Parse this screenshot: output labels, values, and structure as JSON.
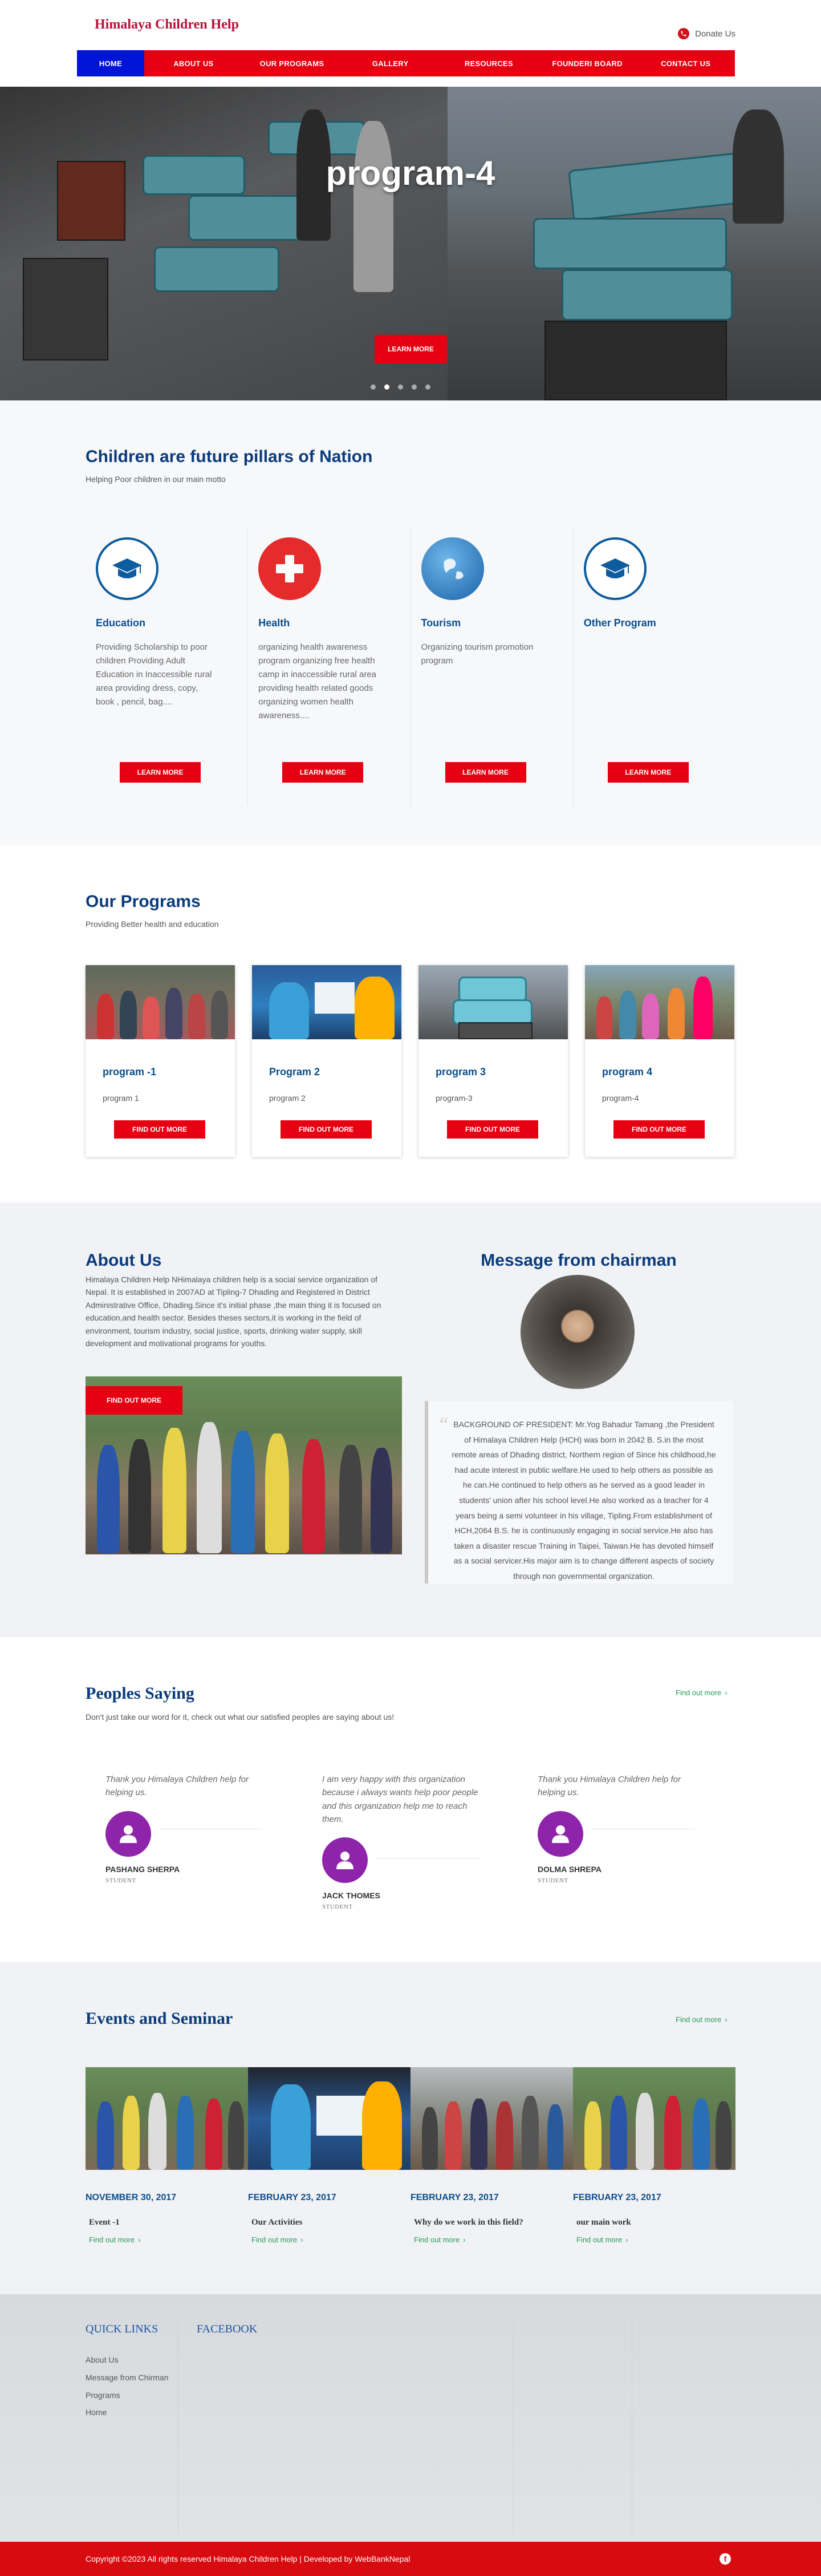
{
  "header": {
    "logo": "Himalaya Children Help",
    "donate": "Donate Us"
  },
  "nav": [
    {
      "label": "HOME"
    },
    {
      "label": "ABOUT US"
    },
    {
      "label": "OUR PROGRAMS"
    },
    {
      "label": "GALLERY"
    },
    {
      "label": "RESOURCES"
    },
    {
      "label": "FOUNDERI BOARD"
    },
    {
      "label": "CONTACT US"
    }
  ],
  "hero": {
    "title": "program-4",
    "button": "LEARN MORE",
    "slides": 5,
    "active_slide": 2
  },
  "pillars": {
    "title": "Children are future pillars of Nation",
    "subtitle": "Helping Poor children in our main motto",
    "items": [
      {
        "name": "Education",
        "icon": "graduation-cap-icon",
        "text": "Providing Scholarship to poor children Providing Adult Education in Inaccessible rural area   providing dress, copy, book , pencil, bag....",
        "button": "LEARN MORE"
      },
      {
        "name": "Health",
        "icon": "medical-cross-icon",
        "text": "organizing health awareness program organizing free health camp in inaccessible rural area providing health related goods organizing women health awareness....",
        "button": "LEARN MORE"
      },
      {
        "name": "Tourism",
        "icon": "globe-icon",
        "text": "Organizing tourism promotion program",
        "button": "LEARN MORE"
      },
      {
        "name": "Other Program",
        "icon": "graduation-cap-icon",
        "text": "",
        "button": "LEARN MORE"
      }
    ]
  },
  "programs": {
    "title": "Our Programs",
    "subtitle": "Providing Better health and education",
    "items": [
      {
        "title": "program -1",
        "text": "program 1",
        "button": "FIND OUT MORE"
      },
      {
        "title": "Program 2",
        "text": "program 2",
        "button": "FIND OUT MORE"
      },
      {
        "title": "program 3",
        "text": "program-3",
        "button": "FIND OUT MORE"
      },
      {
        "title": "program 4",
        "text": "program-4",
        "button": "FIND OUT MORE"
      }
    ]
  },
  "about": {
    "title": "About Us",
    "text": "Himalaya Children Help NHimalaya children help is a social service organization of Nepal. It is established in 2007AD at Tipling-7 Dhading and Registered in District Administrative Office, Dhading.Since it's initial phase ,the main thing it is focused on education,and health sector. Besides theses sectors,it is working in the field of environment, tourism industry, social justice, sports, drinking water supply, skill development and motivational programs for youths.",
    "button": "FIND OUT MORE"
  },
  "chairman": {
    "title": "Message from chairman",
    "message": "BACKGROUND OF PRESIDENT: Mr.Yog Bahadur Tamang ,the President of Himalaya Children Help (HCH) was born in 2042 B. S.in the most remote areas of Dhading district, Northern region of Since his childhood,he had acute interest in public welfare.He used to help others as possible as he can.He continued to help others as he served as a good leader in students' union after his school level.He also worked as a teacher for 4 years being a semi volunteer in his village, Tipling.From establishment of HCH,2064 B.S. he is continuously engaging in social service.He also has taken a disaster rescue Training in Taipei, Taiwan.He has devoted himself as a social servicer.His major aim is to change different aspects of society through non governmental organization."
  },
  "testimonials": {
    "title": "Peoples Saying",
    "subtitle": "Don't just take our word for it, check out what our satisfied peoples are saying about us!",
    "find_more": "Find out more",
    "items": [
      {
        "quote": "Thank you Himalaya Children help for helping us.",
        "name": "PASHANG SHERPA",
        "role": "STUDENT"
      },
      {
        "quote": "I am very happy with this organization because i always wants help poor people and this organization help me to reach them.",
        "name": "JACK THOMES",
        "role": "STUDENT"
      },
      {
        "quote": "Thank you Himalaya Children help for helping us.",
        "name": "DOLMA SHREPA",
        "role": "STUDENT"
      }
    ]
  },
  "events": {
    "title": "Events and Seminar",
    "find_more": "Find out more",
    "items": [
      {
        "date": "NOVEMBER 30, 2017",
        "title": "Event -1",
        "link": "Find out more"
      },
      {
        "date": "FEBRUARY 23, 2017",
        "title": "Our Activities",
        "link": "Find out more"
      },
      {
        "date": "FEBRUARY 23, 2017",
        "title": "Why do we work in this field?",
        "link": "Find out more"
      },
      {
        "date": "FEBRUARY 23, 2017",
        "title": "our main work",
        "link": "Find out more"
      }
    ]
  },
  "footer": {
    "quick_links_title": "QUICK LINKS",
    "facebook_title": "FACEBOOK",
    "links": [
      "About Us",
      "Message from Chirman",
      "Programs",
      "Home"
    ],
    "copyright": "Copyright ©2023 All rights reserved Himalaya Children Help | Developed by WebBankNepal",
    "social_icon": "facebook-icon"
  },
  "colors": {
    "nav_red": "#e60012",
    "nav_active": "#0014d8",
    "heading_blue": "#0b3b7a",
    "testimonial_avatar": "#8e24aa",
    "link_green": "#2a9a5a"
  }
}
